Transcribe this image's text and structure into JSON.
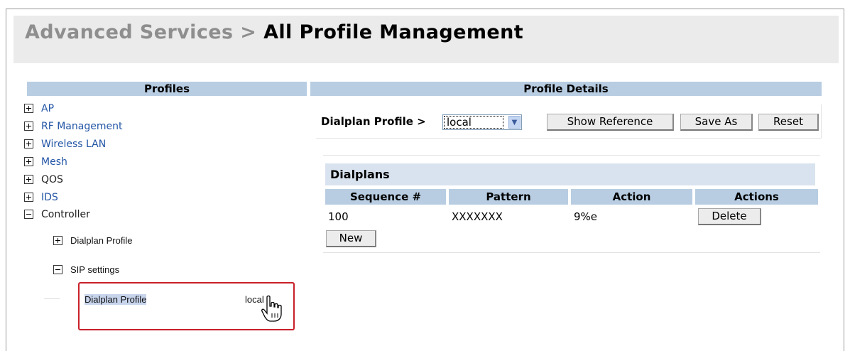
{
  "header": {
    "crumb": "Advanced Services >",
    "current": "All Profile Management"
  },
  "profiles_panel": {
    "title": "Profiles",
    "items": [
      {
        "label": "AP",
        "state": "collapsed"
      },
      {
        "label": "RF Management",
        "state": "collapsed"
      },
      {
        "label": "Wireless LAN",
        "state": "collapsed"
      },
      {
        "label": "Mesh",
        "state": "collapsed"
      },
      {
        "label": "QOS",
        "state": "collapsed"
      },
      {
        "label": "IDS",
        "state": "collapsed"
      },
      {
        "label": "Controller",
        "state": "expanded"
      }
    ],
    "controller_children": [
      {
        "label": "Dialplan Profile",
        "state": "collapsed"
      },
      {
        "label": "SIP settings",
        "state": "expanded"
      }
    ],
    "sip_child": {
      "label": "Dialplan Profile",
      "value": "local"
    }
  },
  "details_panel": {
    "title": "Profile Details",
    "profile_label": "Dialplan Profile >",
    "selected_profile": "local",
    "buttons": {
      "show_reference": "Show Reference",
      "save_as": "Save As",
      "reset": "Reset"
    },
    "dialplans": {
      "title": "Dialplans",
      "columns": [
        "Sequence #",
        "Pattern",
        "Action",
        "Actions"
      ],
      "rows": [
        {
          "sequence": "100",
          "pattern": "XXXXXXX",
          "action": "9%e",
          "button": "Delete"
        }
      ],
      "new_button": "New"
    }
  },
  "colors": {
    "panel_header": "#b8cde2",
    "link": "#2255a5",
    "highlight_border": "#c8202a"
  }
}
